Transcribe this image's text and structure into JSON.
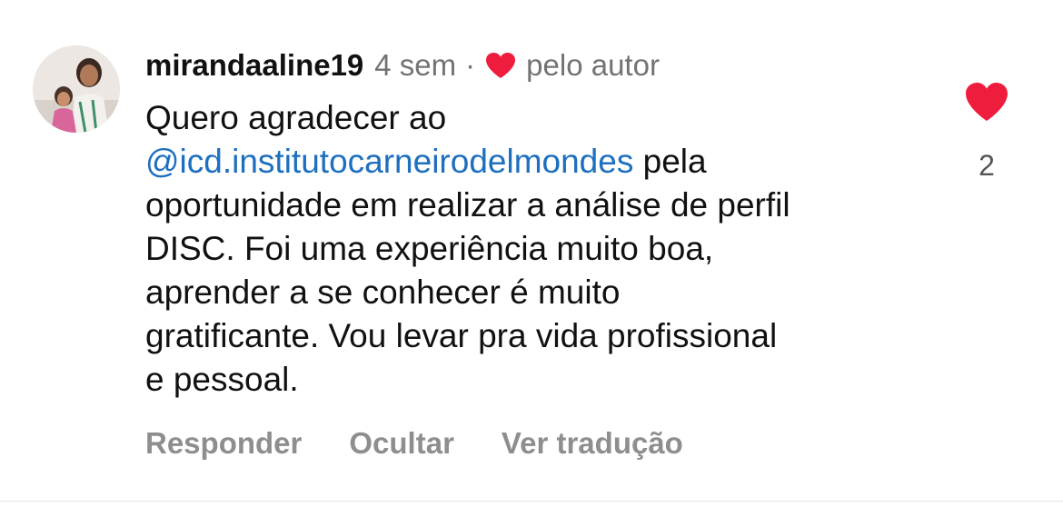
{
  "comment": {
    "username": "mirandaaline19",
    "time": "4 sem",
    "separator": "·",
    "liked_by_author_label": "pelo autor",
    "body": {
      "line1": "Quero agradecer ao",
      "mention": "@icd.institutocarneirodelmondes",
      "line2_rest": " pela",
      "line3": "oportunidade em realizar a análise de perfil",
      "line4": "DISC. Foi uma experiência muito boa,",
      "line5": "aprender a se conhecer é muito",
      "line6": "gratificante. Vou levar pra vida profissional",
      "line7": "e pessoal."
    },
    "actions": {
      "reply": "Responder",
      "hide": "Ocultar",
      "translate": "Ver tradução"
    },
    "like_count": "2"
  },
  "icons": {
    "author_heart": "heart-filled-icon",
    "like": "heart-filled-icon"
  },
  "colors": {
    "heart": "#ee1d3d",
    "mention": "#1d6fbf",
    "muted": "#737373",
    "action": "#8e8e8e"
  }
}
